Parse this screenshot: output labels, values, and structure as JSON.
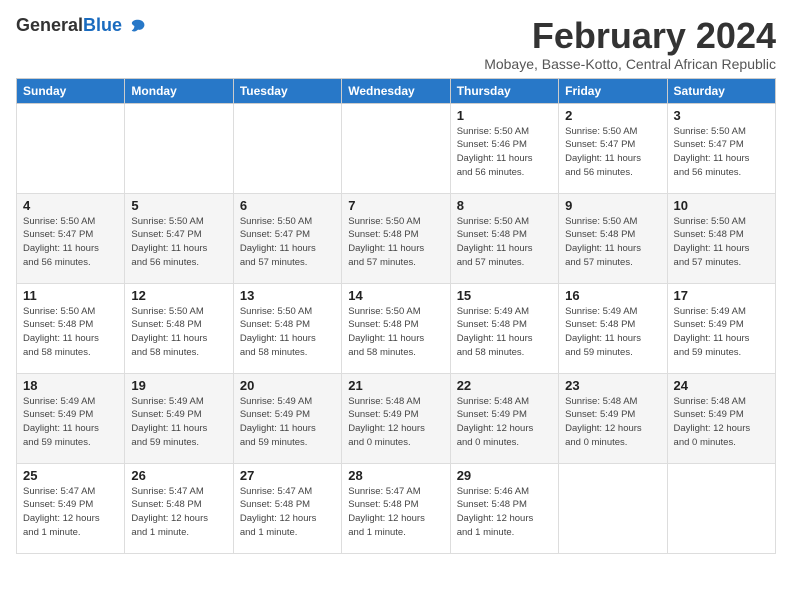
{
  "logo": {
    "general": "General",
    "blue": "Blue"
  },
  "title": "February 2024",
  "subtitle": "Mobaye, Basse-Kotto, Central African Republic",
  "headers": [
    "Sunday",
    "Monday",
    "Tuesday",
    "Wednesday",
    "Thursday",
    "Friday",
    "Saturday"
  ],
  "weeks": [
    [
      {
        "day": "",
        "info": ""
      },
      {
        "day": "",
        "info": ""
      },
      {
        "day": "",
        "info": ""
      },
      {
        "day": "",
        "info": ""
      },
      {
        "day": "1",
        "info": "Sunrise: 5:50 AM\nSunset: 5:46 PM\nDaylight: 11 hours\nand 56 minutes."
      },
      {
        "day": "2",
        "info": "Sunrise: 5:50 AM\nSunset: 5:47 PM\nDaylight: 11 hours\nand 56 minutes."
      },
      {
        "day": "3",
        "info": "Sunrise: 5:50 AM\nSunset: 5:47 PM\nDaylight: 11 hours\nand 56 minutes."
      }
    ],
    [
      {
        "day": "4",
        "info": "Sunrise: 5:50 AM\nSunset: 5:47 PM\nDaylight: 11 hours\nand 56 minutes."
      },
      {
        "day": "5",
        "info": "Sunrise: 5:50 AM\nSunset: 5:47 PM\nDaylight: 11 hours\nand 56 minutes."
      },
      {
        "day": "6",
        "info": "Sunrise: 5:50 AM\nSunset: 5:47 PM\nDaylight: 11 hours\nand 57 minutes."
      },
      {
        "day": "7",
        "info": "Sunrise: 5:50 AM\nSunset: 5:48 PM\nDaylight: 11 hours\nand 57 minutes."
      },
      {
        "day": "8",
        "info": "Sunrise: 5:50 AM\nSunset: 5:48 PM\nDaylight: 11 hours\nand 57 minutes."
      },
      {
        "day": "9",
        "info": "Sunrise: 5:50 AM\nSunset: 5:48 PM\nDaylight: 11 hours\nand 57 minutes."
      },
      {
        "day": "10",
        "info": "Sunrise: 5:50 AM\nSunset: 5:48 PM\nDaylight: 11 hours\nand 57 minutes."
      }
    ],
    [
      {
        "day": "11",
        "info": "Sunrise: 5:50 AM\nSunset: 5:48 PM\nDaylight: 11 hours\nand 58 minutes."
      },
      {
        "day": "12",
        "info": "Sunrise: 5:50 AM\nSunset: 5:48 PM\nDaylight: 11 hours\nand 58 minutes."
      },
      {
        "day": "13",
        "info": "Sunrise: 5:50 AM\nSunset: 5:48 PM\nDaylight: 11 hours\nand 58 minutes."
      },
      {
        "day": "14",
        "info": "Sunrise: 5:50 AM\nSunset: 5:48 PM\nDaylight: 11 hours\nand 58 minutes."
      },
      {
        "day": "15",
        "info": "Sunrise: 5:49 AM\nSunset: 5:48 PM\nDaylight: 11 hours\nand 58 minutes."
      },
      {
        "day": "16",
        "info": "Sunrise: 5:49 AM\nSunset: 5:48 PM\nDaylight: 11 hours\nand 59 minutes."
      },
      {
        "day": "17",
        "info": "Sunrise: 5:49 AM\nSunset: 5:49 PM\nDaylight: 11 hours\nand 59 minutes."
      }
    ],
    [
      {
        "day": "18",
        "info": "Sunrise: 5:49 AM\nSunset: 5:49 PM\nDaylight: 11 hours\nand 59 minutes."
      },
      {
        "day": "19",
        "info": "Sunrise: 5:49 AM\nSunset: 5:49 PM\nDaylight: 11 hours\nand 59 minutes."
      },
      {
        "day": "20",
        "info": "Sunrise: 5:49 AM\nSunset: 5:49 PM\nDaylight: 11 hours\nand 59 minutes."
      },
      {
        "day": "21",
        "info": "Sunrise: 5:48 AM\nSunset: 5:49 PM\nDaylight: 12 hours\nand 0 minutes."
      },
      {
        "day": "22",
        "info": "Sunrise: 5:48 AM\nSunset: 5:49 PM\nDaylight: 12 hours\nand 0 minutes."
      },
      {
        "day": "23",
        "info": "Sunrise: 5:48 AM\nSunset: 5:49 PM\nDaylight: 12 hours\nand 0 minutes."
      },
      {
        "day": "24",
        "info": "Sunrise: 5:48 AM\nSunset: 5:49 PM\nDaylight: 12 hours\nand 0 minutes."
      }
    ],
    [
      {
        "day": "25",
        "info": "Sunrise: 5:47 AM\nSunset: 5:49 PM\nDaylight: 12 hours\nand 1 minute."
      },
      {
        "day": "26",
        "info": "Sunrise: 5:47 AM\nSunset: 5:48 PM\nDaylight: 12 hours\nand 1 minute."
      },
      {
        "day": "27",
        "info": "Sunrise: 5:47 AM\nSunset: 5:48 PM\nDaylight: 12 hours\nand 1 minute."
      },
      {
        "day": "28",
        "info": "Sunrise: 5:47 AM\nSunset: 5:48 PM\nDaylight: 12 hours\nand 1 minute."
      },
      {
        "day": "29",
        "info": "Sunrise: 5:46 AM\nSunset: 5:48 PM\nDaylight: 12 hours\nand 1 minute."
      },
      {
        "day": "",
        "info": ""
      },
      {
        "day": "",
        "info": ""
      }
    ]
  ]
}
